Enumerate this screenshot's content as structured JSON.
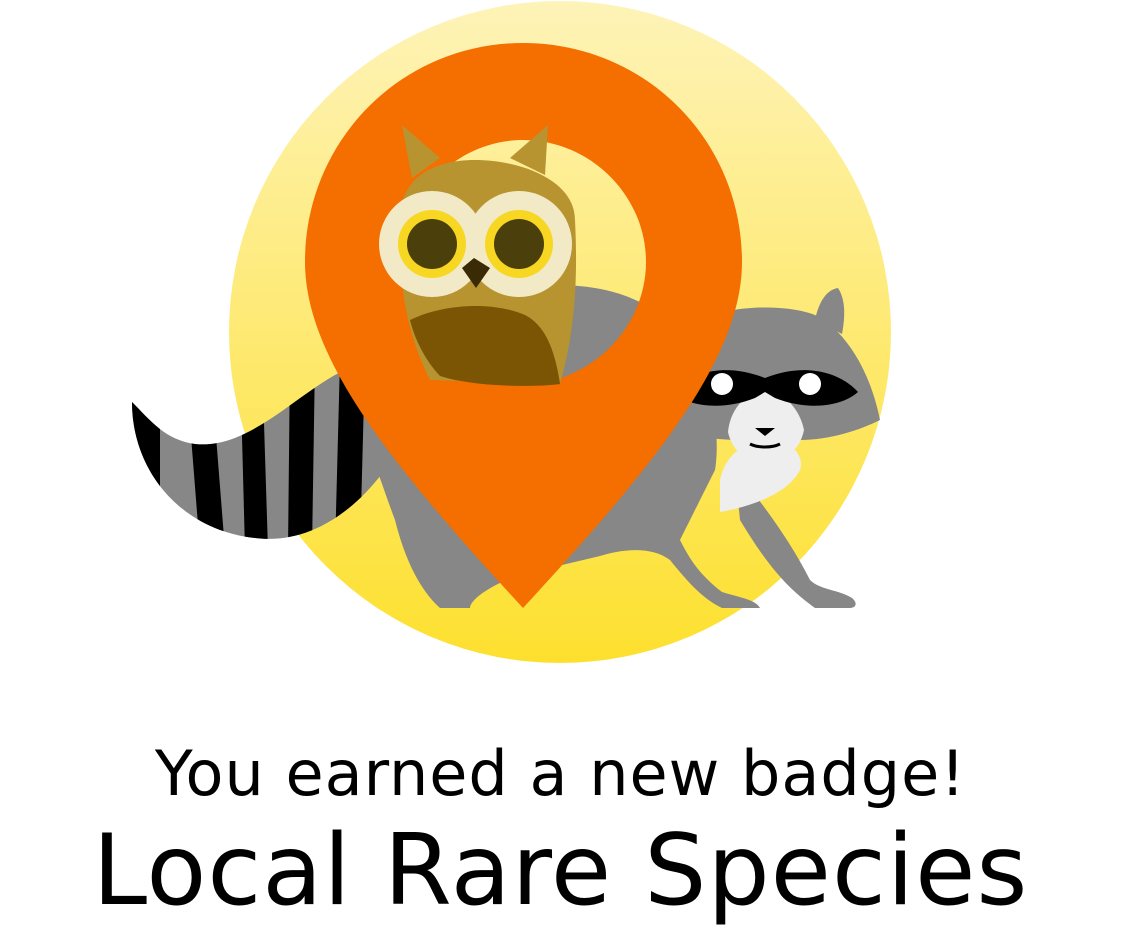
{
  "dialog": {
    "subtitle": "You earned a new badge!",
    "badge_name": "Local Rare Species"
  },
  "illustration": {
    "icons": [
      "sun-circle",
      "map-pin-icon",
      "owl-icon",
      "raccoon-icon"
    ],
    "colors": {
      "sun_top": "#FEF3B8",
      "sun_bottom": "#FDE02E",
      "pin": "#F46E00",
      "owl_body": "#B89431",
      "owl_wing": "#7C5504",
      "raccoon_fur": "#878787",
      "raccoon_dark": "#000000",
      "raccoon_light": "#EEEEEE"
    }
  }
}
